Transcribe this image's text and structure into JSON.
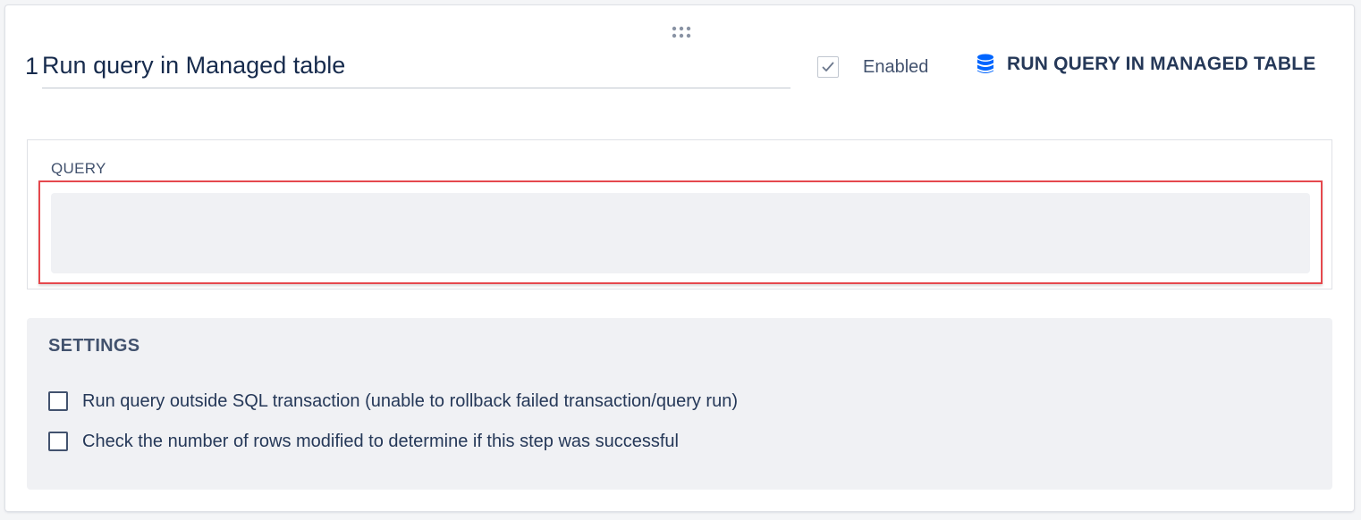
{
  "step": {
    "number": "1",
    "title": "Run query in Managed table",
    "enabled_label": "Enabled",
    "enabled": true,
    "type_label": "RUN QUERY IN MANAGED TABLE",
    "type_icon": "database-icon"
  },
  "query": {
    "label": "QUERY",
    "value": ""
  },
  "settings": {
    "title": "SETTINGS",
    "options": [
      {
        "label": "Run query outside SQL transaction (unable to rollback failed transaction/query run)",
        "checked": false
      },
      {
        "label": "Check the number of rows modified to determine if this step was successful",
        "checked": false
      }
    ]
  },
  "colors": {
    "accent": "#0065ff",
    "highlight": "#e5484d",
    "text": "#172b4d"
  }
}
